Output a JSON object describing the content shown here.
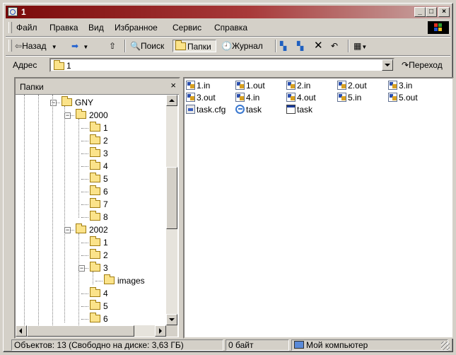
{
  "window": {
    "title": "1"
  },
  "menu": [
    "Файл",
    "Правка",
    "Вид",
    "Избранное",
    "Сервис",
    "Справка"
  ],
  "toolbar": {
    "back": "Назад",
    "search": "Поиск",
    "folders": "Папки",
    "history": "Журнал"
  },
  "address": {
    "label": "Адрес",
    "value": "1",
    "go": "Переход"
  },
  "folders_pane": {
    "title": "Папки",
    "close": "×",
    "tree": [
      {
        "label": "GNY",
        "level": 0,
        "expander": "−"
      },
      {
        "label": "2000",
        "level": 1,
        "expander": "−"
      },
      {
        "label": "1",
        "level": 2
      },
      {
        "label": "2",
        "level": 2
      },
      {
        "label": "3",
        "level": 2
      },
      {
        "label": "4",
        "level": 2
      },
      {
        "label": "5",
        "level": 2
      },
      {
        "label": "6",
        "level": 2
      },
      {
        "label": "7",
        "level": 2
      },
      {
        "label": "8",
        "level": 2
      },
      {
        "label": "2002",
        "level": 1,
        "expander": "−"
      },
      {
        "label": "1",
        "level": 2
      },
      {
        "label": "2",
        "level": 2
      },
      {
        "label": "3",
        "level": 2,
        "expander": "−"
      },
      {
        "label": "images",
        "level": 3
      },
      {
        "label": "4",
        "level": 2
      },
      {
        "label": "5",
        "level": 2
      },
      {
        "label": "6",
        "level": 2
      }
    ]
  },
  "files": [
    {
      "name": "1.in",
      "icon": "doc"
    },
    {
      "name": "1.out",
      "icon": "doc"
    },
    {
      "name": "2.in",
      "icon": "doc"
    },
    {
      "name": "2.out",
      "icon": "doc"
    },
    {
      "name": "3.in",
      "icon": "doc"
    },
    {
      "name": "3.out",
      "icon": "doc"
    },
    {
      "name": "4.in",
      "icon": "doc"
    },
    {
      "name": "4.out",
      "icon": "doc"
    },
    {
      "name": "5.in",
      "icon": "doc"
    },
    {
      "name": "5.out",
      "icon": "doc"
    },
    {
      "name": "task.cfg",
      "icon": "cfg"
    },
    {
      "name": "task",
      "icon": "ie"
    },
    {
      "name": "task",
      "icon": "exe"
    }
  ],
  "status": {
    "objects": "Объектов: 13 (Свободно на диске: 3,63 ГБ)",
    "size": "0 байт",
    "location": "Мой компьютер"
  }
}
